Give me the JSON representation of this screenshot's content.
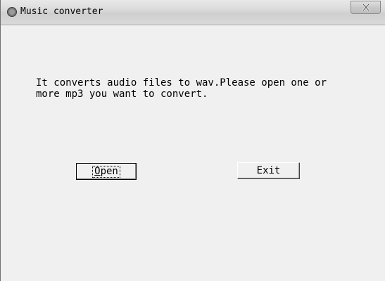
{
  "window": {
    "title": "Music converter",
    "close_glyph": "X",
    "app_icon": "circle-app-icon"
  },
  "content": {
    "message": "It converts audio files to wav.Please open one or\nmore mp3 you want to convert."
  },
  "buttons": {
    "open_mnemonic": "O",
    "open_rest": "pen",
    "exit_label": "Exit"
  },
  "colors": {
    "background": "#f0f0f0",
    "titlebar": "#d9d9d9",
    "text": "#000000"
  }
}
